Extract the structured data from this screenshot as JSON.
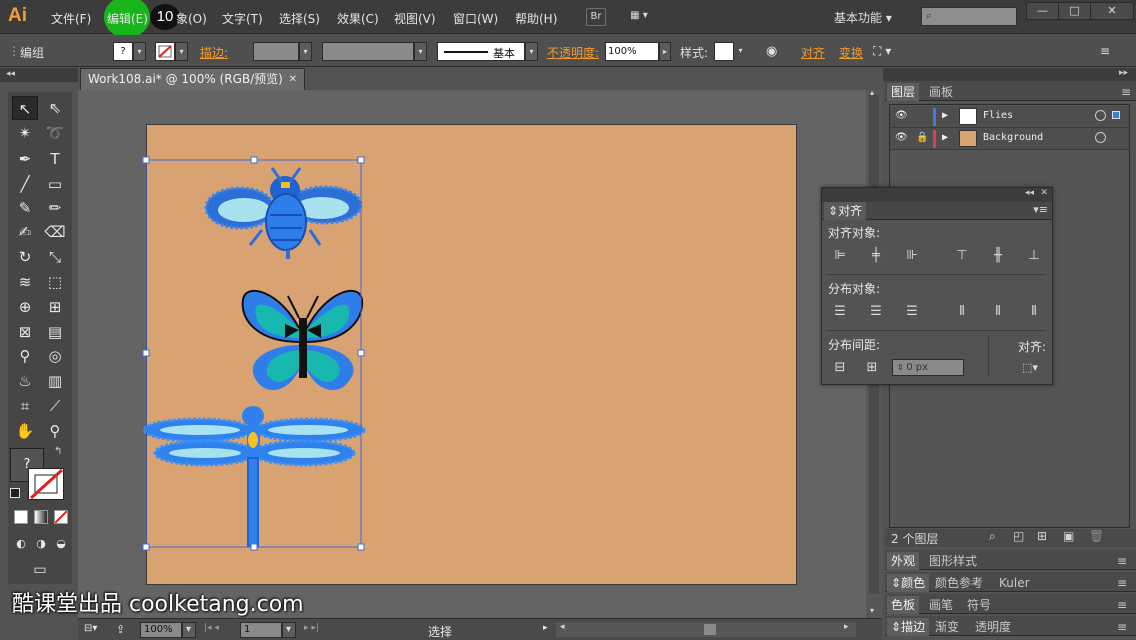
{
  "app": {
    "logo": "Ai"
  },
  "menu": {
    "items": [
      "文件(F)",
      "编辑(E)",
      "象(O)",
      "文字(T)",
      "选择(S)",
      "效果(C)",
      "视图(V)",
      "窗口(W)",
      "帮助(H)"
    ],
    "bridge_label": "Br",
    "workspace": "基本功能",
    "step_badge": "10",
    "highlight_color": "#18b41c"
  },
  "control_bar": {
    "selection_label": "编组",
    "stroke_label": "描边:",
    "stroke_profile": "基本",
    "opacity_label": "不透明度:",
    "opacity_value": "100%",
    "style_label": "样式:",
    "align_label": "对齐",
    "transform_label": "变换",
    "accent_color": "#f39c2c"
  },
  "document": {
    "tab_title": "Work108.ai* @ 100% (RGB/预览)",
    "artboard_color": "#d9a272"
  },
  "tools": {
    "fill_stroke_unknown": "?"
  },
  "status_bar": {
    "zoom": "100%",
    "page": "1",
    "tool_name": "选择"
  },
  "right_panels": {
    "tabs_top": [
      "图层",
      "画板"
    ],
    "layers": [
      {
        "name": "Flies",
        "color": "#3a7de0"
      },
      {
        "name": "Background",
        "color": "#e04040"
      }
    ],
    "layer_count": "2 个图层",
    "tabs_group2": [
      "外观",
      "图形样式"
    ],
    "tabs_group3": [
      "颜色",
      "颜色参考",
      "Kuler"
    ],
    "tabs_group4": [
      "色板",
      "画笔",
      "符号"
    ],
    "tabs_group5": [
      "描边",
      "渐变",
      "透明度"
    ]
  },
  "align_panel": {
    "tab_label": "对齐",
    "align_objects": "对齐对象:",
    "distribute_objects": "分布对象:",
    "distribute_spacing": "分布间距:",
    "align_to": "对齐:",
    "spacing_value": "0 px"
  },
  "watermark": "酷课堂出品 coolketang.com"
}
